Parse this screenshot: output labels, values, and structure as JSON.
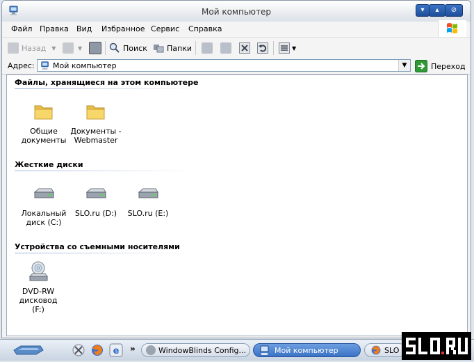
{
  "window": {
    "title": "Мой компьютер"
  },
  "menu": [
    "Файл",
    "Правка",
    "Вид",
    "Избранное",
    "Сервис",
    "Справка"
  ],
  "toolbar": {
    "back": "Назад",
    "search": "Поиск",
    "folders": "Папки"
  },
  "address": {
    "label": "Адрес:",
    "value": "Мой компьютер",
    "go": "Переход"
  },
  "groups": [
    {
      "title": "Файлы, хранящиеся на этом компьютере",
      "items": [
        {
          "line1": "Общие",
          "line2": "документы",
          "icon": "folder-icon"
        },
        {
          "line1": "Документы -",
          "line2": "Webmaster",
          "icon": "folder-icon"
        }
      ]
    },
    {
      "title": "Жесткие диски",
      "items": [
        {
          "line1": "Локальный",
          "line2": "диск (C:)",
          "icon": "drive-icon"
        },
        {
          "line1": "SLO.ru (D:)",
          "line2": "",
          "icon": "drive-icon"
        },
        {
          "line1": "SLO.ru (E:)",
          "line2": "",
          "icon": "drive-icon"
        }
      ]
    },
    {
      "title": "Устройства со съемными носителями",
      "items": [
        {
          "line1": "DVD-RW",
          "line2": "дисковод (F:)",
          "icon": "dvd-drive-icon"
        }
      ]
    }
  ],
  "taskbar": {
    "overflow": "»",
    "tasks": [
      "WindowBlinds Config...",
      "Мой компьютер",
      "SLO"
    ]
  },
  "watermark": "SLO.RU",
  "colors": {
    "accent": "#3a73c5",
    "go_arrow": "#2f9a35",
    "folder": "#f7d66a"
  }
}
